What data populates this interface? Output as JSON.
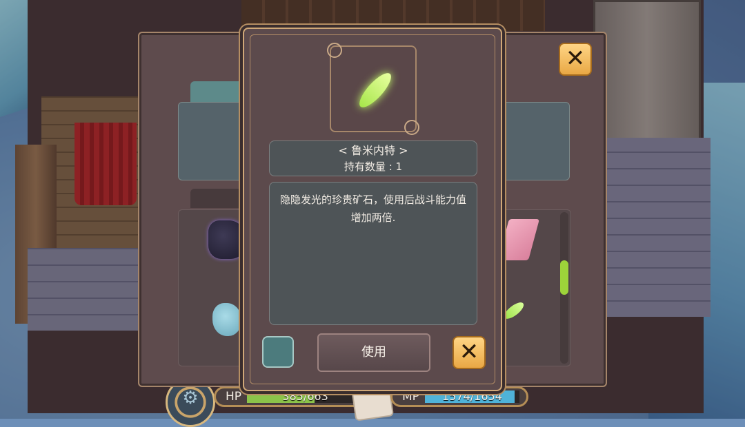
{
  "status": {
    "hp_label": "HP",
    "hp_value": "385/663",
    "hp_fraction": 0.58,
    "mp_label": "MP",
    "mp_value": "1574/1654",
    "mp_fraction": 0.95
  },
  "icons": {
    "settings": "gear-icon",
    "close": "close-icon",
    "item": "green-crystal-leaf"
  },
  "item": {
    "name": "< 鲁米内特 >",
    "quantity": "持有数量 : 1",
    "description": "隐隐发光的珍贵矿石，使用后战斗能力值增加两倍."
  },
  "actions": {
    "use_label": "使用",
    "close_symbol": "✕"
  },
  "colors": {
    "accent_gold": "#e9a845",
    "hp_fill": "#8bc34a",
    "mp_fill": "#4fb3d9",
    "scroll_thumb": "#9dd33a"
  }
}
